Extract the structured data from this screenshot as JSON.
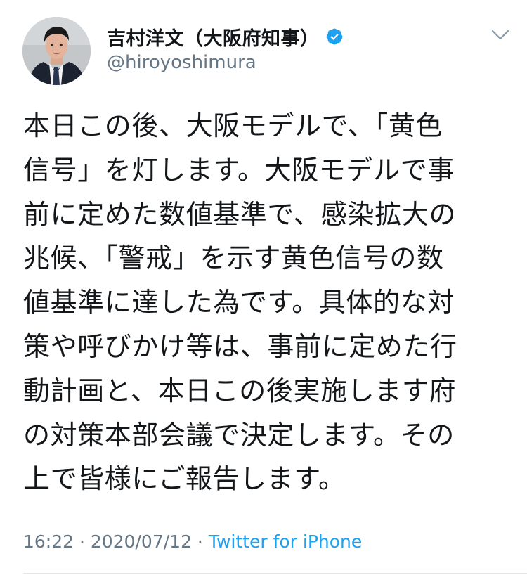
{
  "user": {
    "display_name": "吉村洋文（大阪府知事）",
    "handle": "@hiroyoshimura",
    "verified": true,
    "avatar_icon": "profile-photo-icon"
  },
  "tweet": {
    "lines": [
      "本日この後、大阪モデルで、「黄色",
      "信号」を灯します。大阪モデルで事",
      "前に定めた数値基準で、感染拡大の",
      "兆候、「警戒」を示す黄色信号の数",
      "値基準に達した為です。具体的な対",
      "策や呼びかけ等は、事前に定めた行",
      "動計画と、本日この後実施します府",
      "の対策本部会議で決定します。その",
      "上で皆様にご報告します。"
    ]
  },
  "meta": {
    "time": "16:22",
    "separator1": " · ",
    "date": "2020/07/12",
    "separator2": " · ",
    "source": "Twitter for iPhone"
  },
  "colors": {
    "text": "#14171a",
    "secondary": "#657786",
    "link": "#1da1f2",
    "verified": "#1da1f2"
  },
  "icons": {
    "verified": "verified-badge-icon",
    "menu": "chevron-down-icon"
  }
}
